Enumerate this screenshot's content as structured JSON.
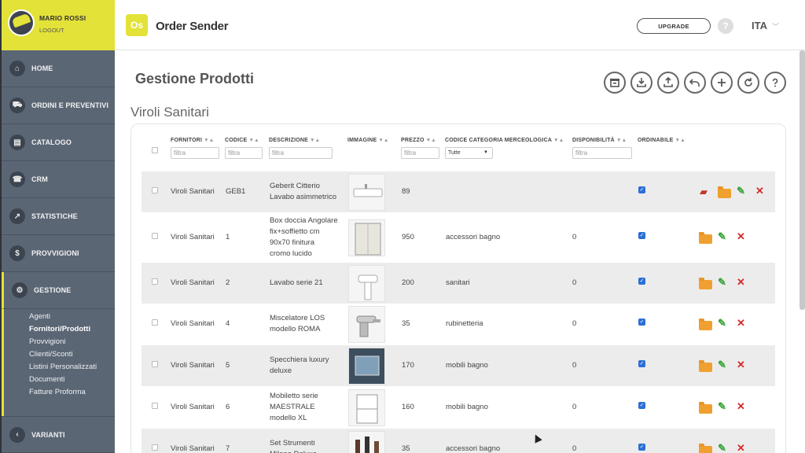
{
  "user": {
    "name": "MARIO ROSSI",
    "logout": "LOGOUT"
  },
  "nav": [
    {
      "label": "HOME",
      "icon": "home-icon",
      "glyph": "⌂"
    },
    {
      "label": "ORDINI E PREVENTIVI",
      "icon": "cart-icon",
      "glyph": "⛟"
    },
    {
      "label": "CATALOGO",
      "icon": "book-icon",
      "glyph": "▤"
    },
    {
      "label": "CRM",
      "icon": "phone-icon",
      "glyph": "☎"
    },
    {
      "label": "STATISTICHE",
      "icon": "chart-icon",
      "glyph": "↗"
    },
    {
      "label": "PROVVIGIONI",
      "icon": "dollar-icon",
      "glyph": "$"
    },
    {
      "label": "GESTIONE",
      "icon": "gear-icon",
      "glyph": "⚙"
    }
  ],
  "submenu": [
    "Agenti",
    "Fornitori/Prodotti",
    "Provvigioni",
    "Clienti/Sconti",
    "Listini Personalizzati",
    "Documenti",
    "Fatture Proforma"
  ],
  "nav_bottom": {
    "label": "VARIANTI",
    "glyph": "‹"
  },
  "topbar": {
    "logo_letters": "Os",
    "logo_text": "Order Sender",
    "upgrade": "UPGRADE",
    "help": "?",
    "lang": "ITA"
  },
  "page": {
    "title": "Gestione Prodotti",
    "supplier": "Viroli Sanitari"
  },
  "toolbar": [
    "archive",
    "download",
    "upload",
    "undo",
    "add",
    "refresh",
    "help"
  ],
  "columns": {
    "fornitori": "FORNITORI",
    "codice": "CODICE",
    "descrizione": "DESCRIZIONE",
    "immagine": "IMMAGINE",
    "prezzo": "PREZZO",
    "categoria": "CODICE CATEGORIA MERCEOLOGICA",
    "disponibilita": "DISPONIBILITÀ",
    "ordinabile": "ORDINABILE"
  },
  "filter_placeholder": "filtra",
  "category_select": "Tutte",
  "rows": [
    {
      "fornitore": "Viroli Sanitari",
      "codice": "GEB1",
      "descrizione": [
        "Geberit Citterio",
        "Lavabo asimmetrico"
      ],
      "prezzo": "89",
      "categoria": "",
      "disponibilita": "",
      "image": "sink"
    },
    {
      "fornitore": "Viroli Sanitari",
      "codice": "1",
      "descrizione": [
        "Box doccia Angolare",
        "fix+soffietto cm",
        "90x70 finitura",
        "cromo lucido"
      ],
      "prezzo": "950",
      "categoria": "accessori bagno",
      "disponibilita": "0",
      "image": "shower"
    },
    {
      "fornitore": "Viroli Sanitari",
      "codice": "2",
      "descrizione": [
        "Lavabo serie 21"
      ],
      "prezzo": "200",
      "categoria": "sanitari",
      "disponibilita": "0",
      "image": "pedestal"
    },
    {
      "fornitore": "Viroli Sanitari",
      "codice": "4",
      "descrizione": [
        "Miscelatore LOS",
        "modello ROMA"
      ],
      "prezzo": "35",
      "categoria": "rubinetteria",
      "disponibilita": "0",
      "image": "faucet"
    },
    {
      "fornitore": "Viroli Sanitari",
      "codice": "5",
      "descrizione": [
        "Specchiera luxury",
        "deluxe"
      ],
      "prezzo": "170",
      "categoria": "mobili bagno",
      "disponibilita": "0",
      "image": "mirror"
    },
    {
      "fornitore": "Viroli Sanitari",
      "codice": "6",
      "descrizione": [
        "Mobiletto serie",
        "MAESTRALE",
        "modello XL"
      ],
      "prezzo": "160",
      "categoria": "mobili bagno",
      "disponibilita": "0",
      "image": "cabinet"
    },
    {
      "fornitore": "Viroli Sanitari",
      "codice": "7",
      "descrizione": [
        "Set Strumenti",
        "Milano Deluxe"
      ],
      "prezzo": "35",
      "categoria": "accessori bagno",
      "disponibilita": "0",
      "image": "tools"
    }
  ],
  "colors": {
    "accent": "#e3e239",
    "sidebar": "#5b6675",
    "folder": "#f0a030",
    "edit": "#3ba53b",
    "delete": "#d42a2a",
    "check": "#2b6fd6"
  }
}
